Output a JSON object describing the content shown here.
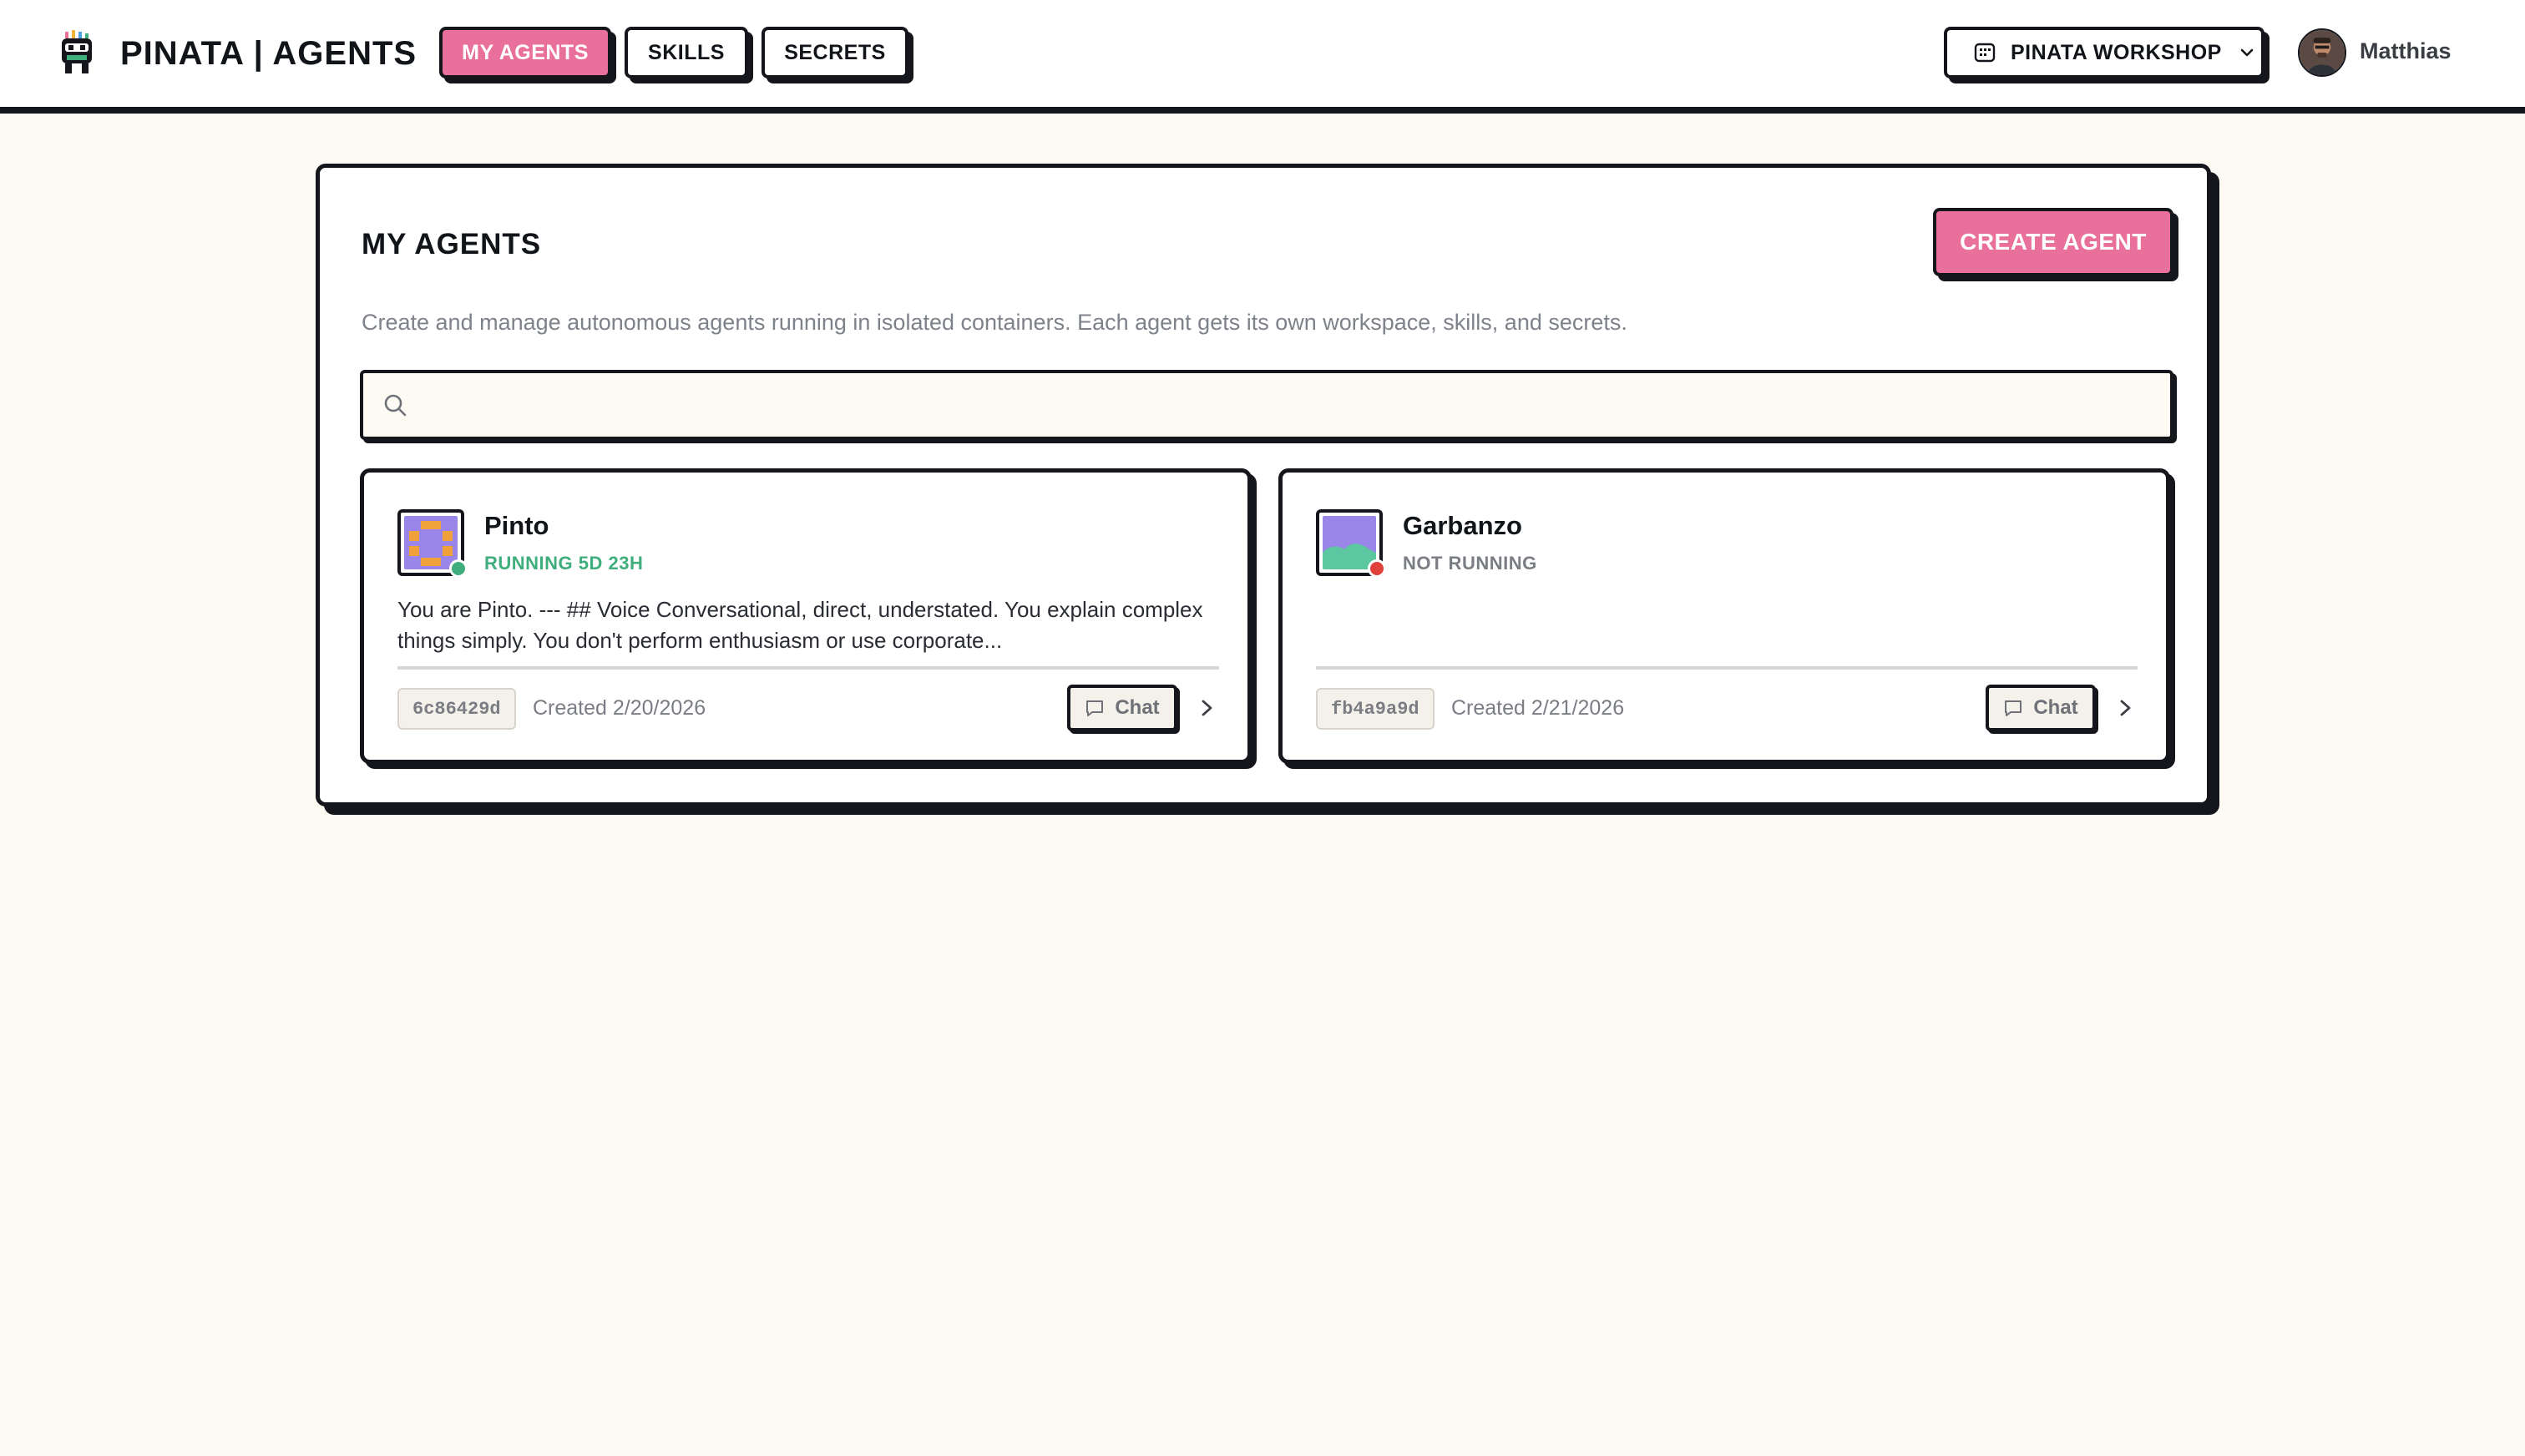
{
  "header": {
    "brand": "PINATA | AGENTS",
    "nav": [
      {
        "label": "MY AGENTS",
        "active": true
      },
      {
        "label": "SKILLS",
        "active": false
      },
      {
        "label": "SECRETS",
        "active": false
      }
    ],
    "workspace": "PINATA WORKSHOP",
    "user_name": "Matthias"
  },
  "main": {
    "title": "MY AGENTS",
    "create_button": "CREATE AGENT",
    "description": "Create and manage autonomous agents running in isolated containers. Each agent gets its own workspace, skills, and secrets.",
    "search": {
      "placeholder": "",
      "value": ""
    },
    "agents": [
      {
        "name": "Pinto",
        "status": "RUNNING 5D 23H",
        "status_color": "#3fae7c",
        "description": "You are Pinto. --- ## Voice Conversational, direct, understated. You explain complex things simply. You don't perform enthusiasm or use corporate...",
        "id": "6c86429d",
        "created": "Created 2/20/2026",
        "chat_label": "Chat"
      },
      {
        "name": "Garbanzo",
        "status": "NOT RUNNING",
        "status_color": "#7a7d84",
        "description": "",
        "id": "fb4a9a9d",
        "created": "Created 2/21/2026",
        "chat_label": "Chat"
      }
    ]
  },
  "colors": {
    "accent": "#e8709b",
    "background": "#fdfaf3",
    "border": "#14161c",
    "running_dot": "#3fae7c",
    "stopped_dot": "#e0413a"
  },
  "icons": [
    "pinata-logo-icon",
    "workspace-icon",
    "chevron-down-icon",
    "search-icon",
    "chat-icon",
    "chevron-right-icon"
  ]
}
